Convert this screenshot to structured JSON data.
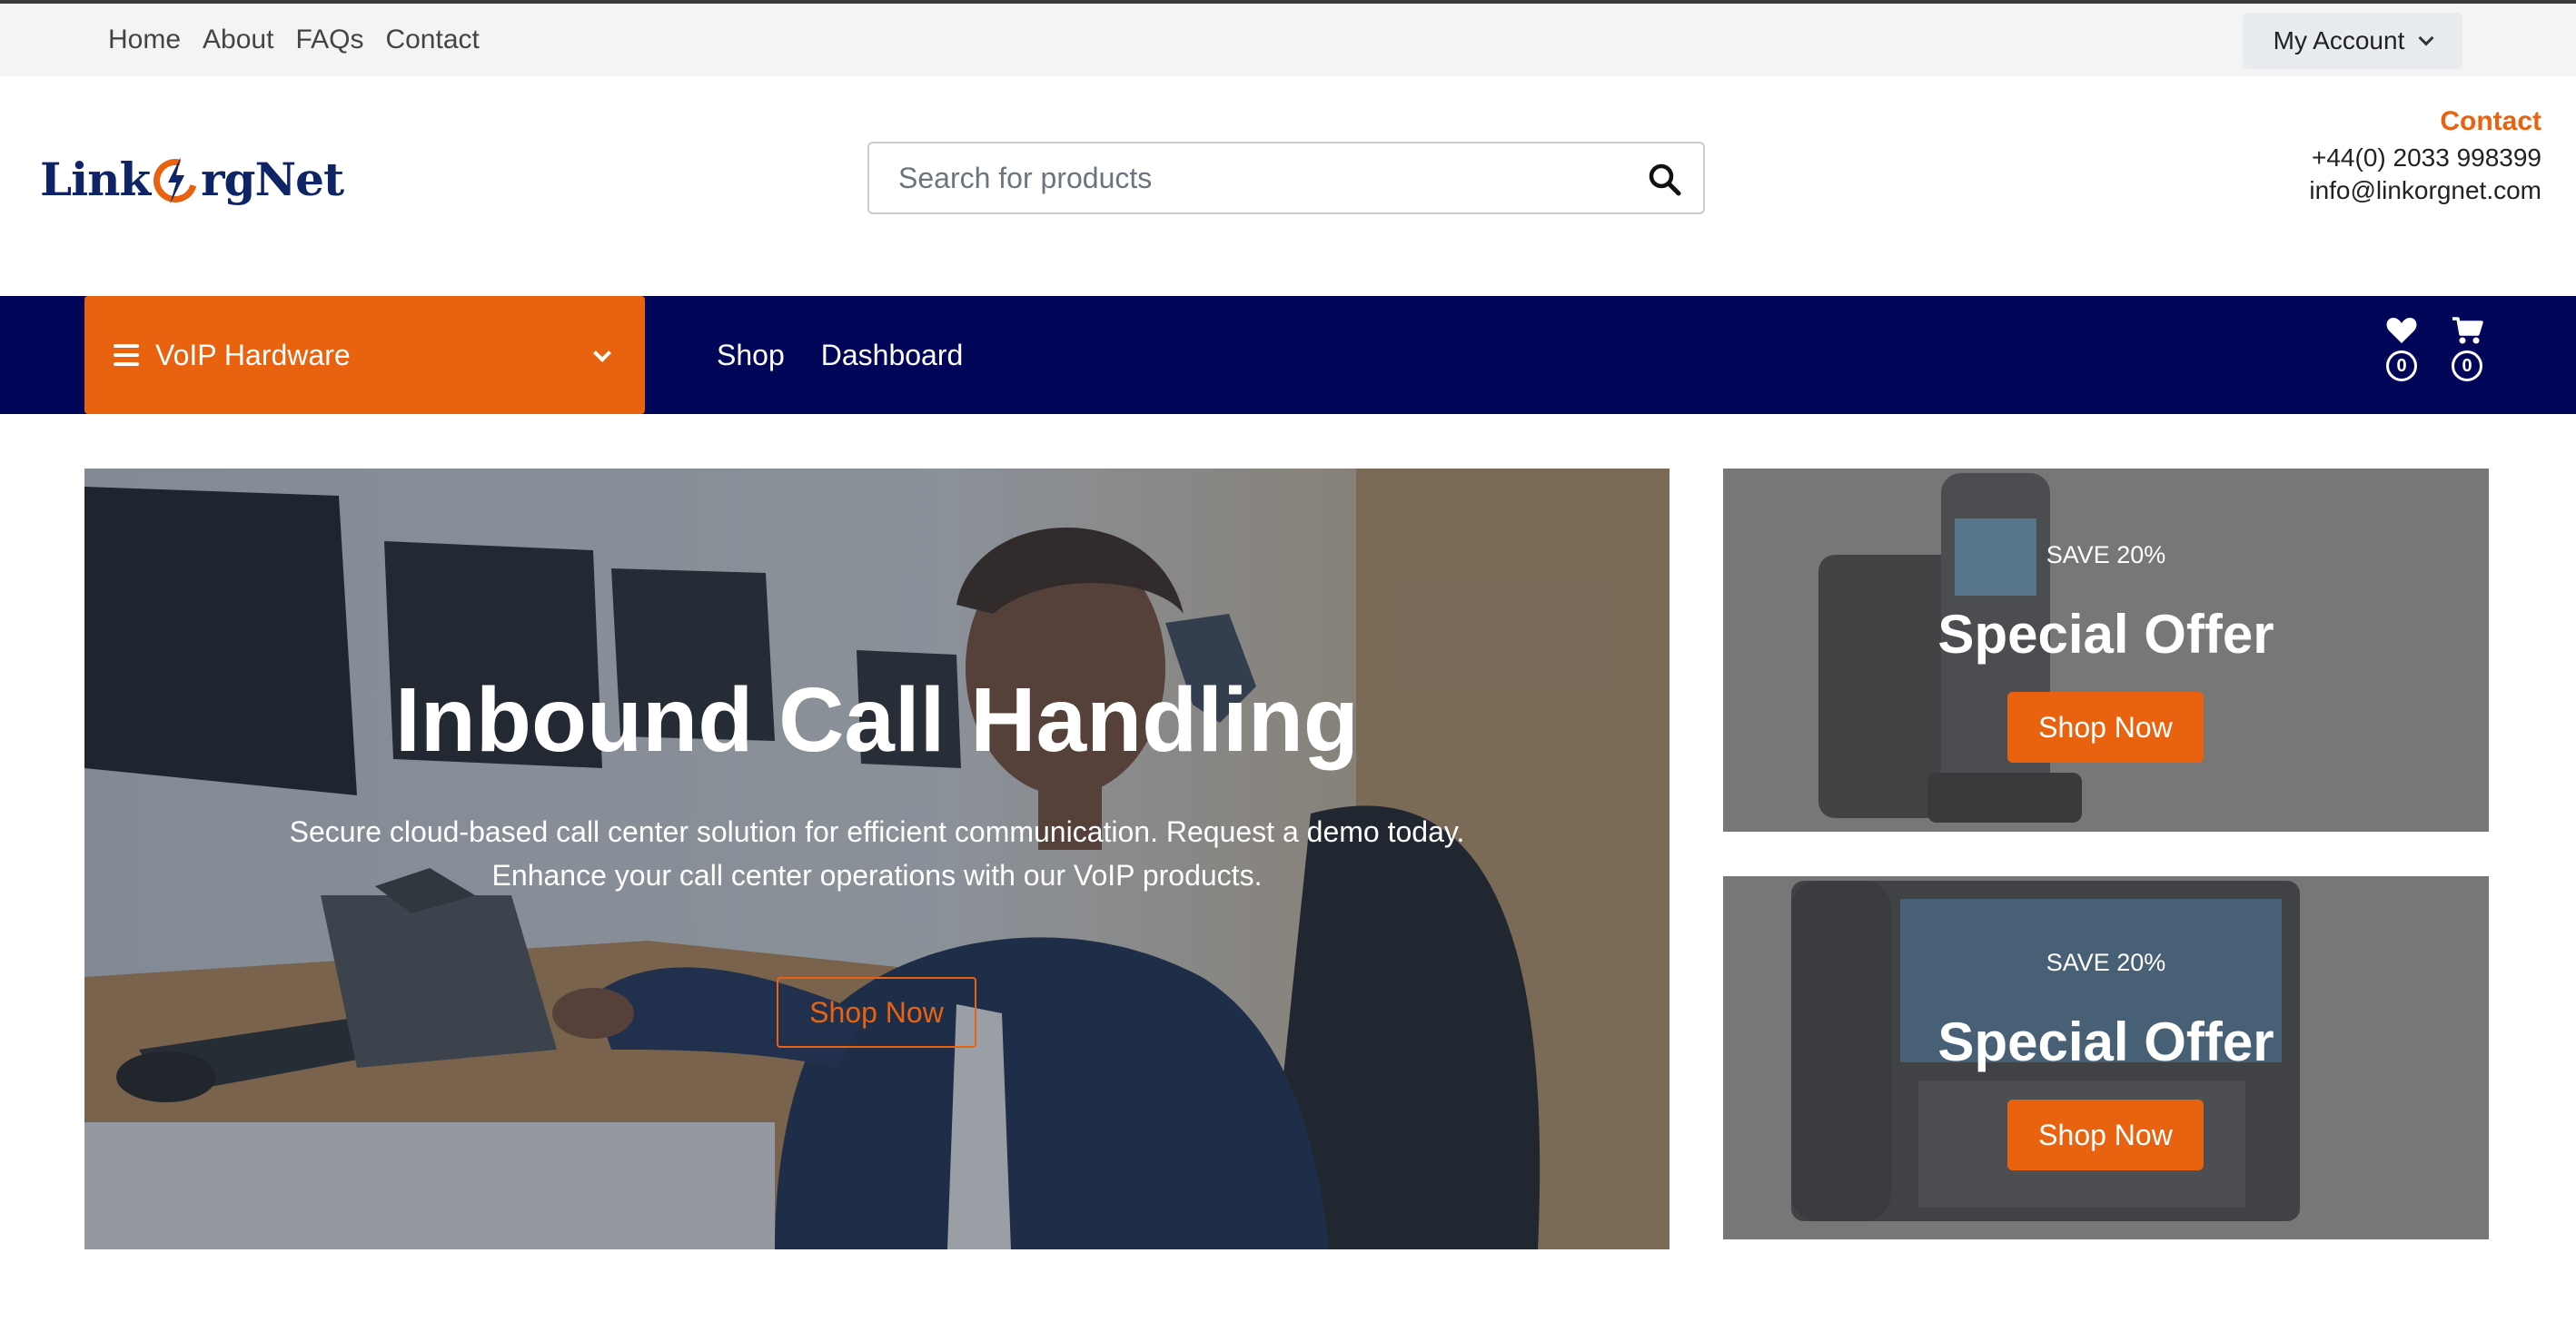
{
  "topbar": {
    "nav": [
      "Home",
      "About",
      "FAQs",
      "Contact"
    ],
    "account_label": "My Account"
  },
  "header": {
    "logo": {
      "part1": "Link",
      "part2": "rgNet"
    },
    "search_placeholder": "Search for products",
    "contact": {
      "title": "Contact",
      "phone": "+44(0) 2033 998399",
      "email": "info@linkorgnet.com"
    }
  },
  "navbar": {
    "category_label": "VoIP Hardware",
    "links": [
      "Shop",
      "Dashboard"
    ],
    "wishlist_count": "0",
    "cart_count": "0"
  },
  "hero": {
    "title": "Inbound Call Handling",
    "text_line1": "Secure cloud-based call center solution for efficient communication. Request a demo today.",
    "text_line2": "Enhance your call center operations with our VoIP products.",
    "button": "Shop Now"
  },
  "offers": [
    {
      "save": "SAVE 20%",
      "title": "Special Offer",
      "button": "Shop Now"
    },
    {
      "save": "SAVE 20%",
      "title": "Special Offer",
      "button": "Shop Now"
    }
  ],
  "colors": {
    "accent": "#e8620f",
    "navy": "#010659",
    "topbar_bg": "#f4f4f5"
  },
  "icons": [
    "chevron-down-icon",
    "search-icon",
    "hamburger-icon",
    "heart-icon",
    "cart-icon"
  ]
}
